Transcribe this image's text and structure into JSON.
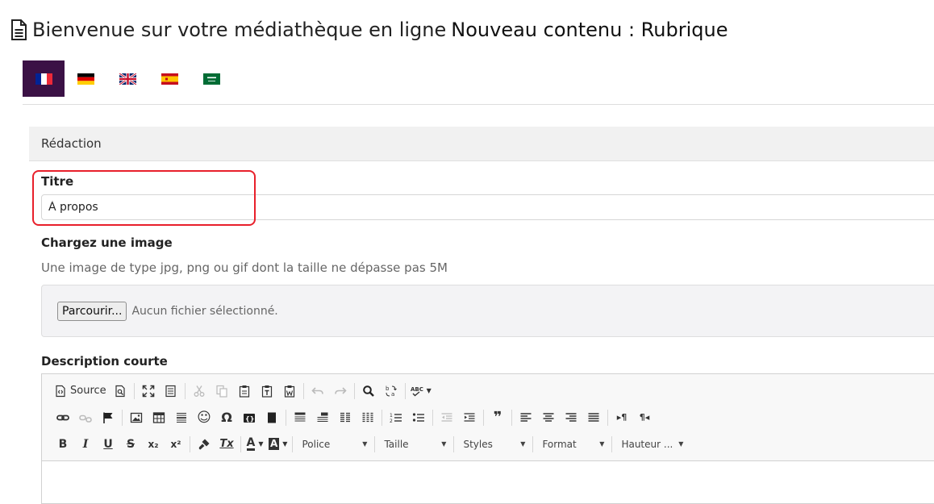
{
  "header": {
    "title_prefix": "Bienvenue sur votre médiathèque en ligne",
    "title_suffix": "Nouveau contenu : Rubrique"
  },
  "languages": [
    {
      "code": "fr",
      "active": true
    },
    {
      "code": "de",
      "active": false
    },
    {
      "code": "en",
      "active": false
    },
    {
      "code": "es",
      "active": false
    },
    {
      "code": "ar",
      "active": false
    }
  ],
  "panel": {
    "heading": "Rédaction"
  },
  "titre": {
    "label": "Titre",
    "value": "À propos"
  },
  "image": {
    "label": "Chargez une image",
    "hint": "Une image de type jpg, png ou gif dont la taille ne dépasse pas 5M",
    "button": "Parcourir...",
    "status": "Aucun fichier sélectionné."
  },
  "description": {
    "label": "Description courte",
    "toolbar": {
      "source_label": "Source",
      "combos": {
        "font": "Police",
        "size": "Taille",
        "styles": "Styles",
        "format": "Format",
        "height": "Hauteur ..."
      },
      "glyphs": {
        "blockquote": "❞",
        "ltr": "▸¶",
        "rtl": "¶◂",
        "bold": "B",
        "italic": "I",
        "underline": "U",
        "strike": "S",
        "subscript": "x₂",
        "superscript": "x²",
        "text_color": "A",
        "bg_color": "A",
        "special_char": "Ω",
        "smiley": "☺",
        "remove_format": "Tx"
      }
    }
  },
  "colors": {
    "accent": "#3b1145",
    "highlight": "#e8202b"
  }
}
